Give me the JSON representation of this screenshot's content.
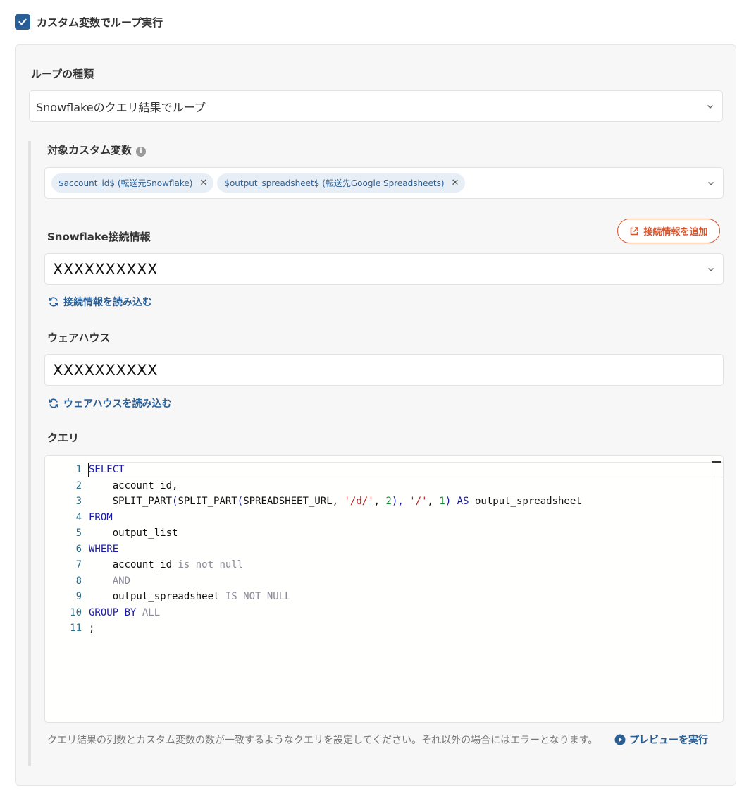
{
  "loop_option": {
    "checked": true,
    "label": "カスタム変数でループ実行"
  },
  "loop_type": {
    "label": "ループの種類",
    "value": "Snowflakeのクエリ結果でループ"
  },
  "target_vars": {
    "label": "対象カスタム変数",
    "tags": [
      "$account_id$ (転送元Snowflake)",
      "$output_spreadsheet$ (転送先Google Spreadsheets)"
    ]
  },
  "connection": {
    "label": "Snowflake接続情報",
    "add_button": "接続情報を追加",
    "value": "XXXXXXXXXX",
    "reload_link": "接続情報を読み込む"
  },
  "warehouse": {
    "label": "ウェアハウス",
    "value": "XXXXXXXXXX",
    "reload_link": "ウェアハウスを読み込む"
  },
  "query": {
    "label": "クエリ",
    "line_numbers": [
      "1",
      "2",
      "3",
      "4",
      "5",
      "6",
      "7",
      "8",
      "9",
      "10",
      "11"
    ],
    "lines": [
      [
        {
          "t": "SELECT",
          "c": "kw"
        }
      ],
      [
        {
          "t": "    account_id,",
          "c": ""
        }
      ],
      [
        {
          "t": "    SPLIT_PART",
          "c": ""
        },
        {
          "t": "(",
          "c": "kw"
        },
        {
          "t": "SPLIT_PART",
          "c": ""
        },
        {
          "t": "(",
          "c": "kw"
        },
        {
          "t": "SPREADSHEET_URL, ",
          "c": ""
        },
        {
          "t": "'/d/'",
          "c": "str"
        },
        {
          "t": ", ",
          "c": ""
        },
        {
          "t": "2",
          "c": "num"
        },
        {
          "t": "), ",
          "c": "kw"
        },
        {
          "t": "'/'",
          "c": "str"
        },
        {
          "t": ", ",
          "c": ""
        },
        {
          "t": "1",
          "c": "num"
        },
        {
          "t": ") AS ",
          "c": "kw"
        },
        {
          "t": "output_spreadsheet",
          "c": ""
        }
      ],
      [
        {
          "t": "FROM",
          "c": "kw"
        }
      ],
      [
        {
          "t": "    output_list",
          "c": ""
        }
      ],
      [
        {
          "t": "WHERE",
          "c": "kw"
        }
      ],
      [
        {
          "t": "    account_id ",
          "c": ""
        },
        {
          "t": "is not null",
          "c": "gray"
        }
      ],
      [
        {
          "t": "    AND",
          "c": "gray"
        }
      ],
      [
        {
          "t": "    output_spreadsheet ",
          "c": ""
        },
        {
          "t": "IS NOT NULL",
          "c": "gray"
        }
      ],
      [
        {
          "t": "GROUP BY ",
          "c": "kw"
        },
        {
          "t": "ALL",
          "c": "gray"
        }
      ],
      [
        {
          "t": ";",
          "c": ""
        }
      ]
    ]
  },
  "hint_text": "クエリ結果の列数とカスタム変数の数が一致するようなクエリを設定してください。それ以外の場合にはエラーとなります。",
  "preview_button": "プレビューを実行",
  "colors": {
    "accent": "#2a5f96",
    "danger": "#d9552c",
    "panel_bg": "#f7f7f7"
  }
}
